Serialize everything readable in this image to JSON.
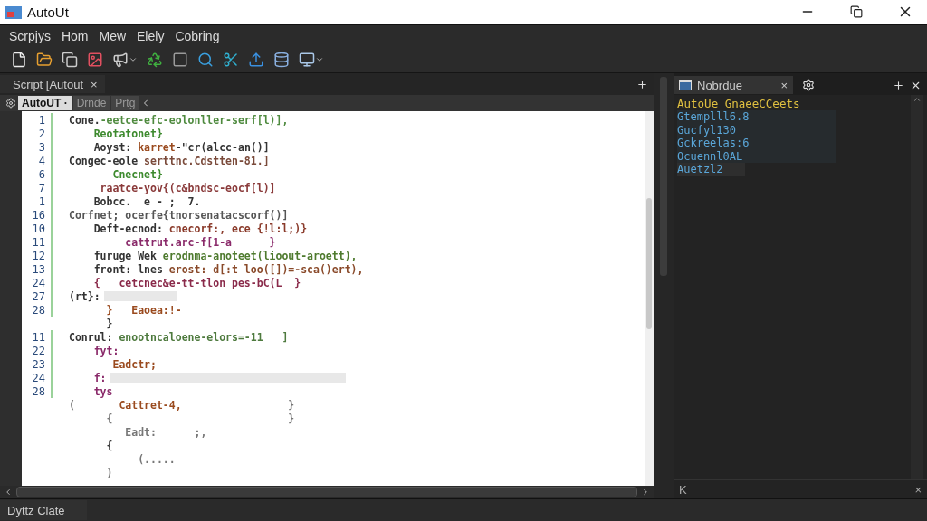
{
  "window": {
    "title": "AutoUt"
  },
  "menu": [
    "Scrpjys",
    "Hom",
    "Mew",
    "Elely",
    "Cobring"
  ],
  "document_tab": {
    "label": "Script [Autout",
    "close": "×"
  },
  "editor_tabs": [
    {
      "label": "AutoUT ·",
      "selected": true
    },
    {
      "label": "Drnde",
      "selected": false
    },
    {
      "label": "Prtg",
      "selected": false
    }
  ],
  "code_lines": [
    {
      "number": "1",
      "highlighted": false,
      "segments": [
        {
          "text": "Cone.",
          "color": "#333333"
        },
        {
          "text": "-eetce-efc-eolonller-serf[l)],",
          "color": "#4e8a3e"
        }
      ]
    },
    {
      "number": "2",
      "highlighted": false,
      "segments": [
        {
          "text": "    Reotatonet}",
          "color": "#3d8a2e"
        }
      ]
    },
    {
      "number": "3",
      "highlighted": false,
      "segments": [
        {
          "text": "    Aoyst: ",
          "color": "#333333"
        },
        {
          "text": "karret",
          "color": "#9a4a1e"
        },
        {
          "text": "-\"cr(alcc-an()]",
          "color": "#333333"
        }
      ]
    },
    {
      "number": "4",
      "highlighted": false,
      "segments": [
        {
          "text": "Congec-eole ",
          "color": "#333333"
        },
        {
          "text": "serttnc.Cdstten-81.]",
          "color": "#7a4a3a"
        }
      ]
    },
    {
      "number": "6",
      "highlighted": false,
      "segments": [
        {
          "text": "       Cnecnet}",
          "color": "#3d8a2e"
        }
      ]
    },
    {
      "number": "7",
      "highlighted": false,
      "segments": [
        {
          "text": "     raatce-yov{(c&bndsc-eocf[l)]",
          "color": "#8a3a3a"
        }
      ]
    },
    {
      "number": "1",
      "highlighted": false,
      "segments": [
        {
          "text": "    Bobcc.  e - ;  7.",
          "color": "#333333"
        }
      ]
    },
    {
      "number": "16",
      "highlighted": false,
      "segments": [
        {
          "text": "Corfnet; ocerfe{tnorsenatacscorf()]",
          "color": "#555555"
        }
      ]
    },
    {
      "number": "10",
      "highlighted": false,
      "segments": [
        {
          "text": "    Deft-ecnod: ",
          "color": "#333333"
        },
        {
          "text": "cnecorf:, ece {!l:l;)}",
          "color": "#8a3a2a"
        }
      ]
    },
    {
      "number": "11",
      "highlighted": false,
      "segments": [
        {
          "text": "         cattrut.arc-f[1-a      }",
          "color": "#8a2a6a"
        }
      ]
    },
    {
      "number": "12",
      "highlighted": false,
      "segments": [
        {
          "text": "    furuge Wek ",
          "color": "#333333"
        },
        {
          "text": "erodnma-anoteet(lioout-aroett),",
          "color": "#4e7a2e"
        }
      ]
    },
    {
      "number": "13",
      "highlighted": false,
      "segments": [
        {
          "text": "    front: lnes ",
          "color": "#333333"
        },
        {
          "text": "erost: d[:t loo([])=-sca()ert),",
          "color": "#8a4a2a"
        }
      ]
    },
    {
      "number": "24",
      "highlighted": false,
      "segments": [
        {
          "text": "    {   cetcnec&e-tt-tlon pes-bC(L  }",
          "color": "#8a2a4a"
        }
      ]
    },
    {
      "number": "27",
      "highlighted": true,
      "segments": [
        {
          "text": "(rt}:",
          "color": "#333333"
        }
      ]
    },
    {
      "number": "28",
      "highlighted": false,
      "segments": [
        {
          "text": "      }   Eaoea:!-",
          "color": "#9a4a1e"
        }
      ]
    },
    {
      "highlighted": false,
      "segments": [
        {
          "text": "      }",
          "color": "#333333"
        }
      ]
    },
    {
      "number": "11",
      "highlighted": false,
      "segments": [
        {
          "text": "Conrul: ",
          "color": "#333333"
        },
        {
          "text": "enootncaloene-elors=-11   ]",
          "color": "#4e7a3e"
        }
      ]
    },
    {
      "number": "22",
      "highlighted": false,
      "segments": [
        {
          "text": "    fyt:",
          "color": "#8a2a6a"
        }
      ]
    },
    {
      "number": "23",
      "highlighted": false,
      "segments": [
        {
          "text": "       Eadctr;",
          "color": "#9a4a1e"
        }
      ]
    },
    {
      "number": "24",
      "highlighted": true,
      "segments": [
        {
          "text": "    f:",
          "color": "#8a2a6a"
        }
      ]
    },
    {
      "number": "28",
      "highlighted": false,
      "segments": [
        {
          "text": "    tys",
          "color": "#8a2a6a"
        }
      ]
    },
    {
      "highlighted": false,
      "segments": [
        {
          "text": "(       ",
          "color": "#777777"
        },
        {
          "text": "Cattret-4,",
          "color": "#9a4a1e"
        },
        {
          "text": "                 }",
          "color": "#777777"
        }
      ]
    },
    {
      "highlighted": false,
      "segments": [
        {
          "text": "      {                            }",
          "color": "#777777"
        }
      ]
    },
    {
      "highlighted": false,
      "segments": [
        {
          "text": "         Eadt:      ;,",
          "color": "#777777"
        }
      ]
    },
    {
      "highlighted": false,
      "segments": [
        {
          "text": "      {",
          "color": "#333333"
        }
      ]
    },
    {
      "highlighted": false,
      "segments": [
        {
          "text": "           (.....",
          "color": "#777777"
        }
      ]
    },
    {
      "highlighted": false,
      "segments": [
        {
          "text": "      )",
          "color": "#777777"
        }
      ]
    }
  ],
  "side_panel": {
    "tab": "Nobrdue",
    "close": "×",
    "header": "AutoUe GnaeeCCeets",
    "items": [
      {
        "label": "Gtemplll6.8",
        "selected": false
      },
      {
        "label": "Gucfyl130",
        "selected": false
      },
      {
        "label": "Gckreelas:6",
        "selected": false
      },
      {
        "label": "Ocuennl0AL",
        "selected": false
      },
      {
        "label": "Auetzl2",
        "selected": true
      }
    ],
    "search": {
      "value": "K",
      "clear": "×"
    }
  },
  "status_bar": {
    "text": "Dyttz Clate"
  }
}
